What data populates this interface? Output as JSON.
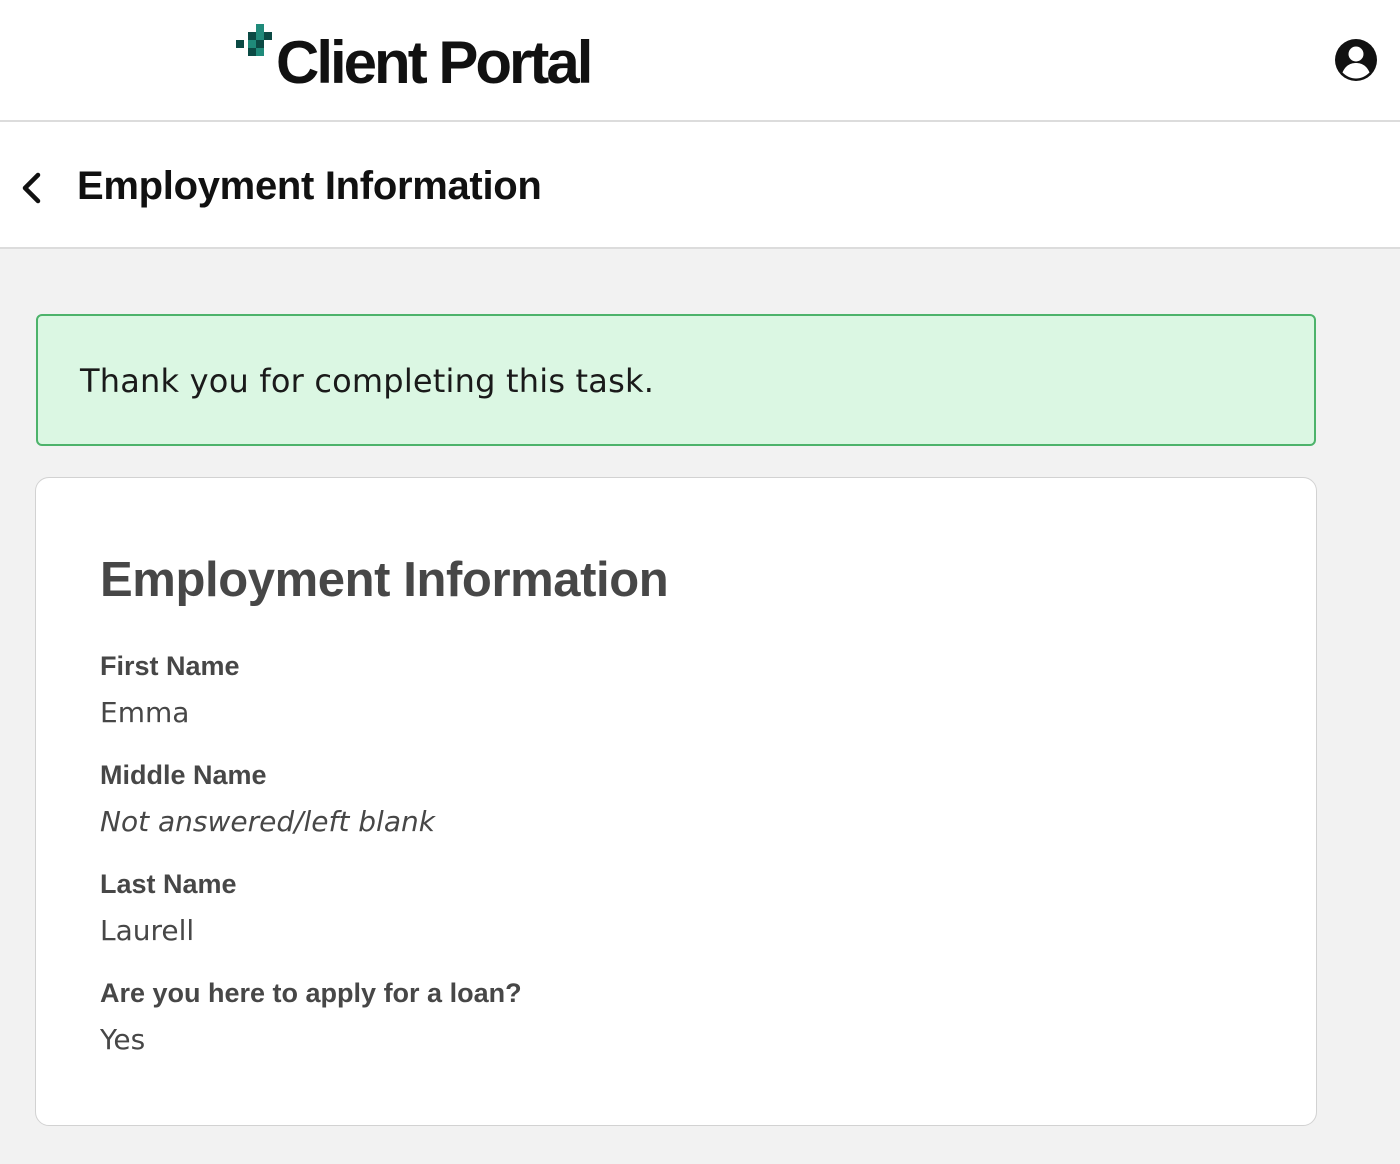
{
  "app": {
    "logo_text": "Client Portal",
    "brand_colors": {
      "dark": "#0b4a44",
      "teal": "#1f8a7a"
    }
  },
  "header": {
    "account_icon": "account-circle-icon"
  },
  "subheader": {
    "back_icon": "chevron-left-icon",
    "title": "Employment Information"
  },
  "alert": {
    "message": "Thank you for completing this task.",
    "colors": {
      "background": "#dbf7e3",
      "border": "#4db36b"
    }
  },
  "card": {
    "title": "Employment Information",
    "fields": [
      {
        "label": "First Name",
        "value": "Emma"
      },
      {
        "label": "Middle Name",
        "value": "Not answered/left blank"
      },
      {
        "label": "Last Name",
        "value": "Laurell"
      },
      {
        "label": "Are you here to apply for a loan?",
        "value": "Yes"
      }
    ]
  }
}
